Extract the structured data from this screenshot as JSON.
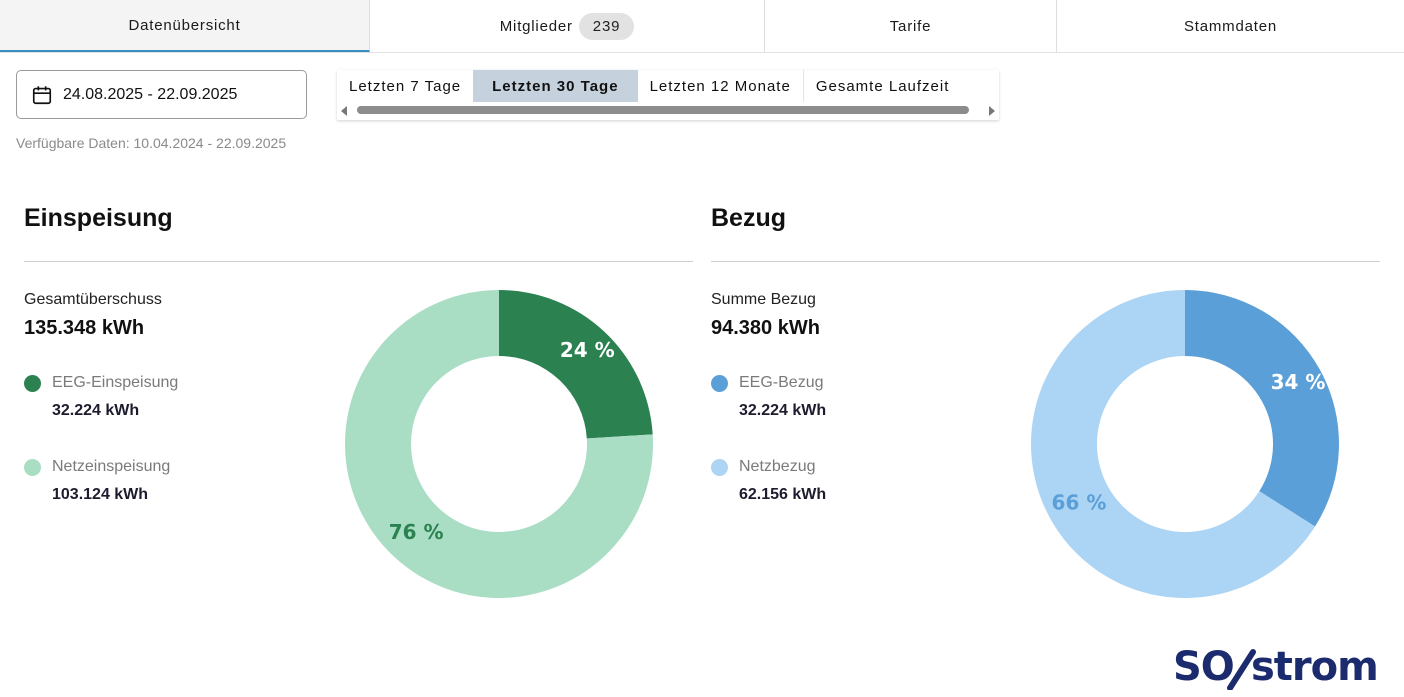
{
  "tabs": {
    "overview": "Datenübersicht",
    "members": "Mitglieder",
    "members_count": "239",
    "tariffs": "Tarife",
    "master_data": "Stammdaten"
  },
  "filter": {
    "date_range": "24.08.2025 - 22.09.2025",
    "available": "Verfügbare Daten: 10.04.2024 - 22.09.2025",
    "ranges": [
      "Letzten 7 Tage",
      "Letzten 30 Tage",
      "Letzten 12 Monate",
      "Gesamte Laufzeit"
    ],
    "selected_range": "Letzten 30 Tage"
  },
  "feed_in": {
    "title": "Einspeisung",
    "total_label": "Gesamtüberschuss",
    "total_value": "135.348 kWh",
    "items": [
      {
        "label": "EEG-Einspeisung",
        "value": "32.224 kWh",
        "color": "#2b8250"
      },
      {
        "label": "Netzeinspeisung",
        "value": "103.124 kWh",
        "color": "#a9dec5"
      }
    ]
  },
  "consumption": {
    "title": "Bezug",
    "total_label": "Summe Bezug",
    "total_value": "94.380 kWh",
    "items": [
      {
        "label": "EEG-Bezug",
        "value": "32.224 kWh",
        "color": "#5b9fd8"
      },
      {
        "label": "Netzbezug",
        "value": "62.156 kWh",
        "color": "#acd4f5"
      }
    ]
  },
  "chart_data": [
    {
      "type": "pie",
      "categories": [
        "EEG-Einspeisung",
        "Netzeinspeisung"
      ],
      "values": [
        24,
        76
      ],
      "labels": [
        "24 %",
        "76 %"
      ],
      "colors": [
        "#2b8250",
        "#a9dec5"
      ],
      "label_colors": [
        "#ffffff",
        "#2b8250"
      ]
    },
    {
      "type": "pie",
      "categories": [
        "EEG-Bezug",
        "Netzbezug"
      ],
      "values": [
        34,
        66
      ],
      "labels": [
        "34 %",
        "66 %"
      ],
      "colors": [
        "#5b9fd8",
        "#acd4f5"
      ],
      "label_colors": [
        "#ffffff",
        "#5b9fd8"
      ]
    }
  ],
  "logo": {
    "text_left": "SO",
    "text_right": "strom",
    "color": "#1c2a6e"
  }
}
